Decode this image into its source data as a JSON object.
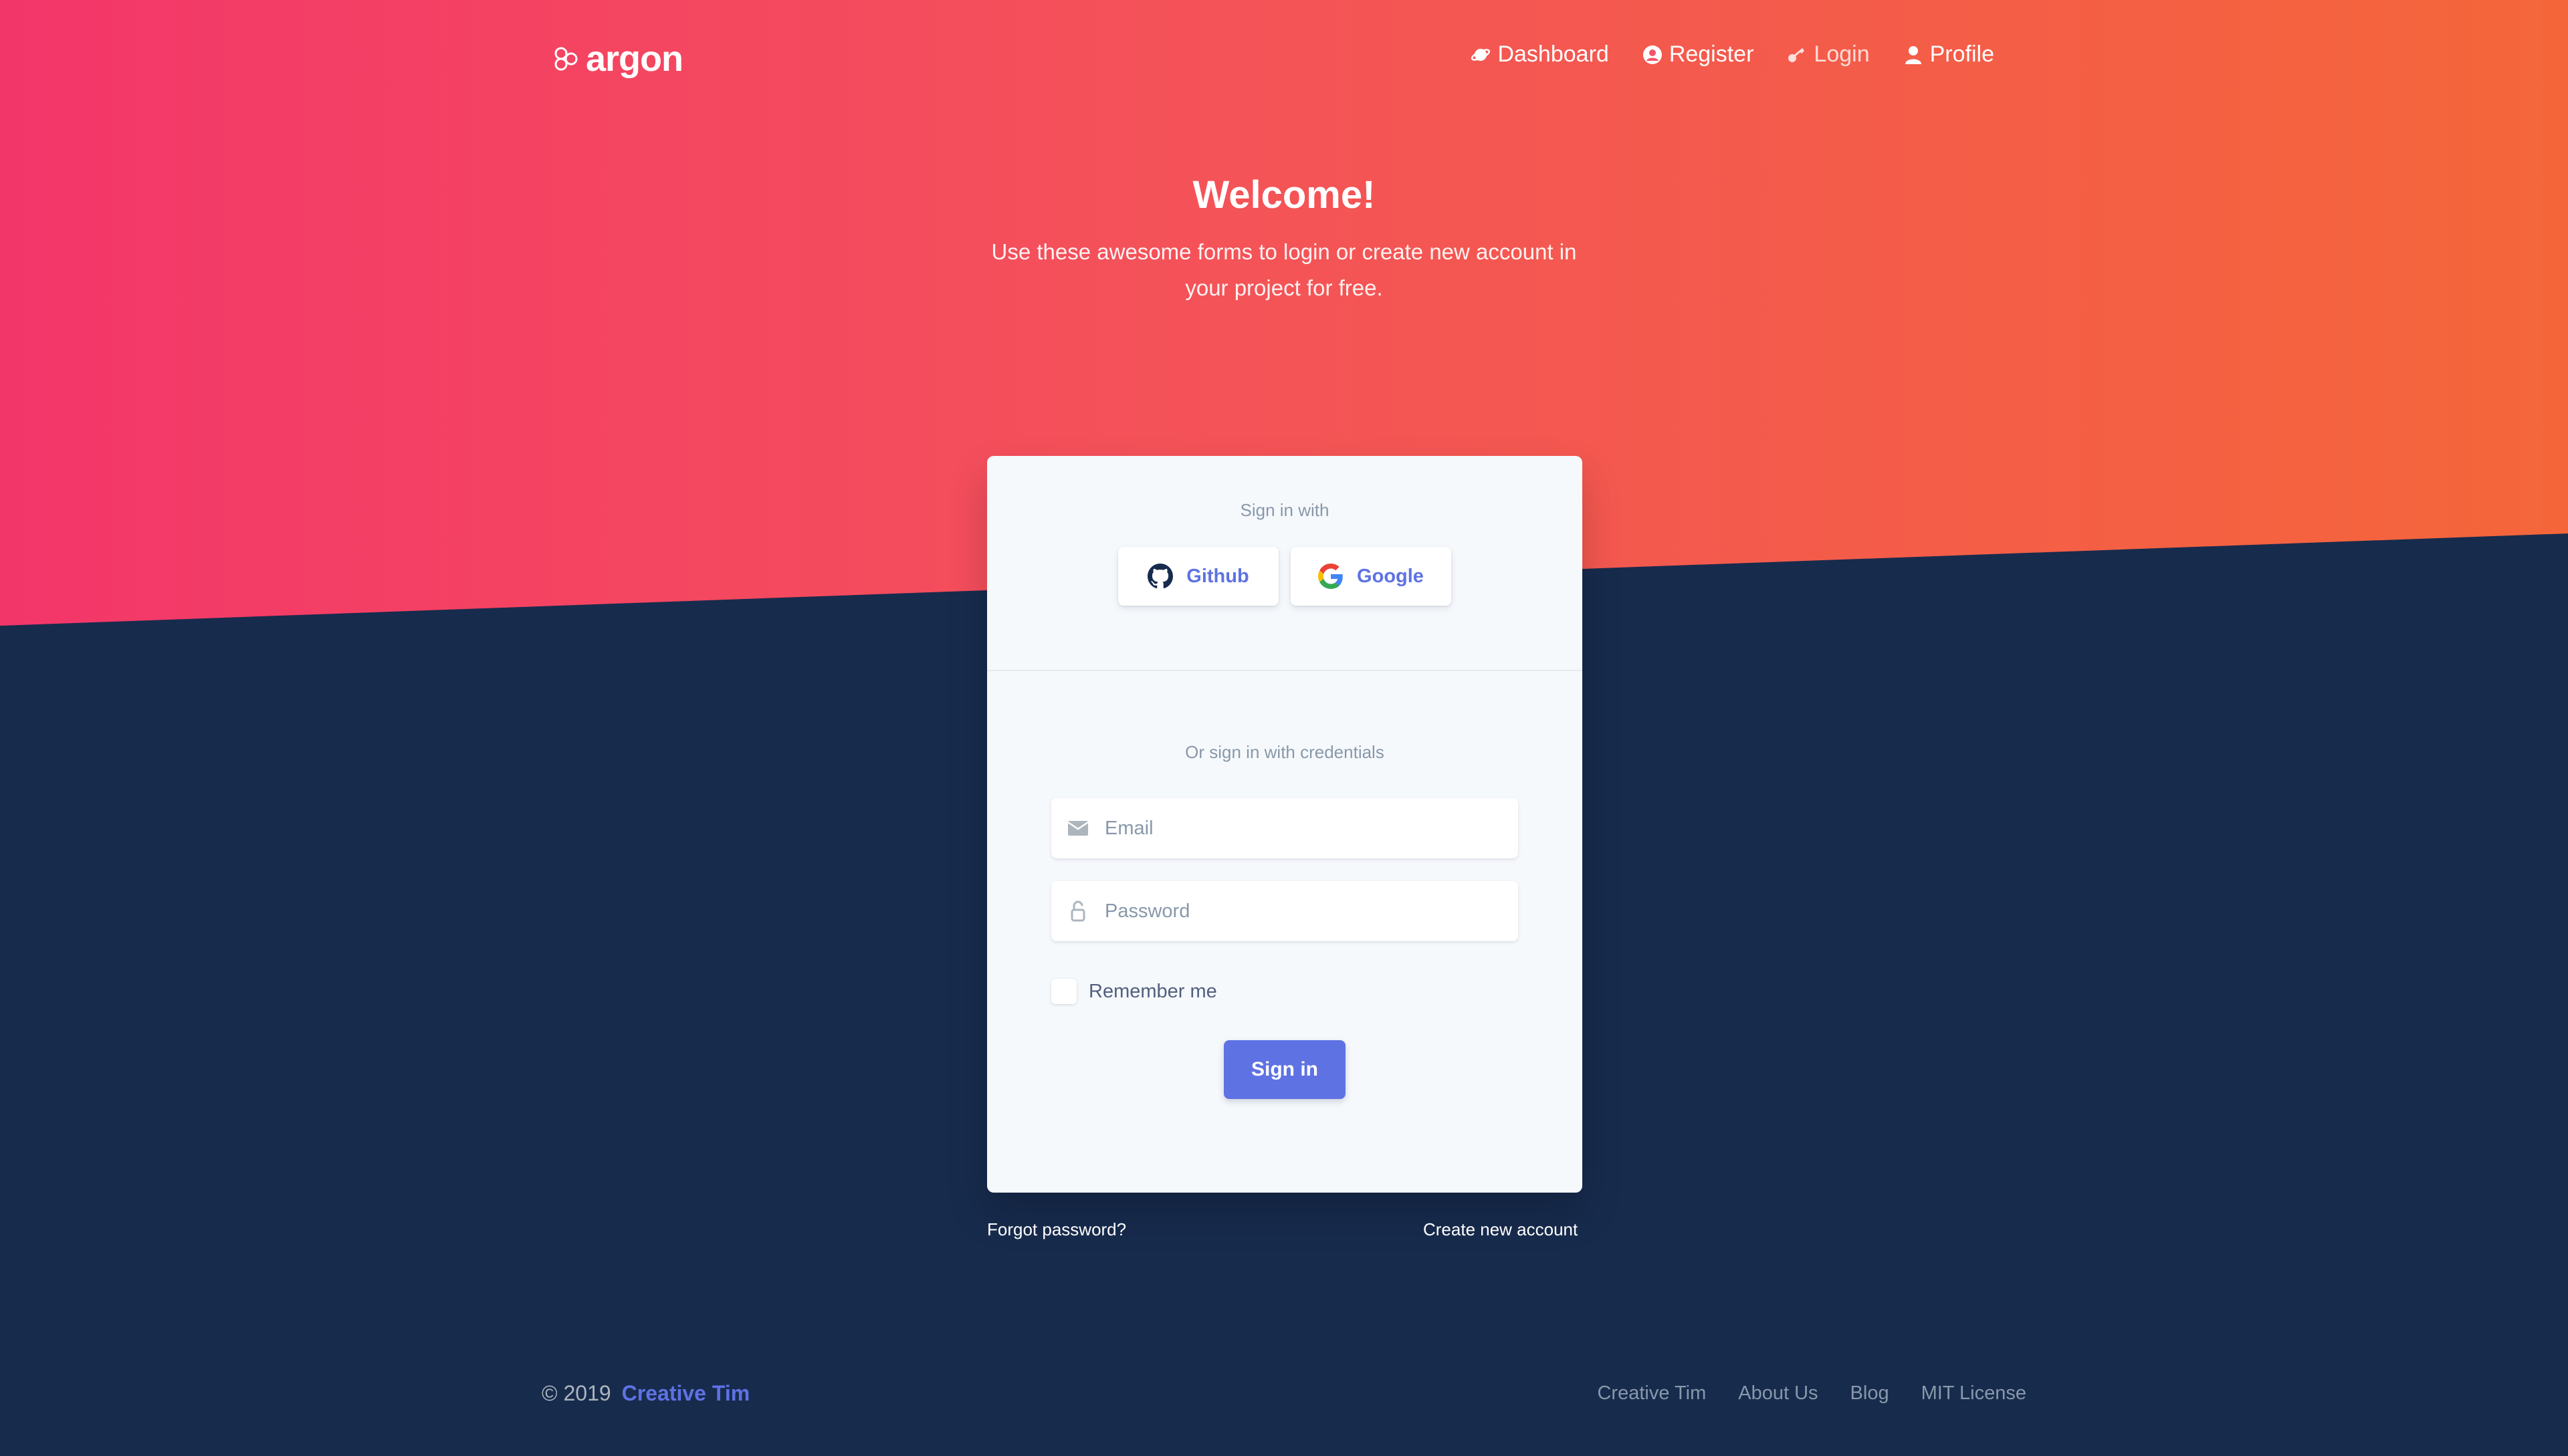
{
  "brand": {
    "name": "argon"
  },
  "nav": {
    "items": [
      {
        "label": "Dashboard",
        "icon": "planet-icon"
      },
      {
        "label": "Register",
        "icon": "circle-user-icon"
      },
      {
        "label": "Login",
        "icon": "key-icon"
      },
      {
        "label": "Profile",
        "icon": "user-icon"
      }
    ]
  },
  "hero": {
    "title": "Welcome!",
    "subtitle": "Use these awesome forms to login or create new account in your project for free."
  },
  "card": {
    "social_heading": "Sign in with",
    "github_label": "Github",
    "google_label": "Google",
    "credentials_heading": "Or sign in with credentials",
    "email_placeholder": "Email",
    "password_placeholder": "Password",
    "remember_label": "Remember me",
    "submit_label": "Sign in"
  },
  "links": {
    "forgot": "Forgot password?",
    "create": "Create new account"
  },
  "footer": {
    "copyright": "© 2019",
    "brand_link": "Creative Tim",
    "links": [
      "Creative Tim",
      "About Us",
      "Blog",
      "MIT License"
    ]
  },
  "colors": {
    "primary": "#5e72e4",
    "dark_bg": "#172b4d",
    "gradient_start": "#f3366a",
    "gradient_end": "#f4663a"
  }
}
